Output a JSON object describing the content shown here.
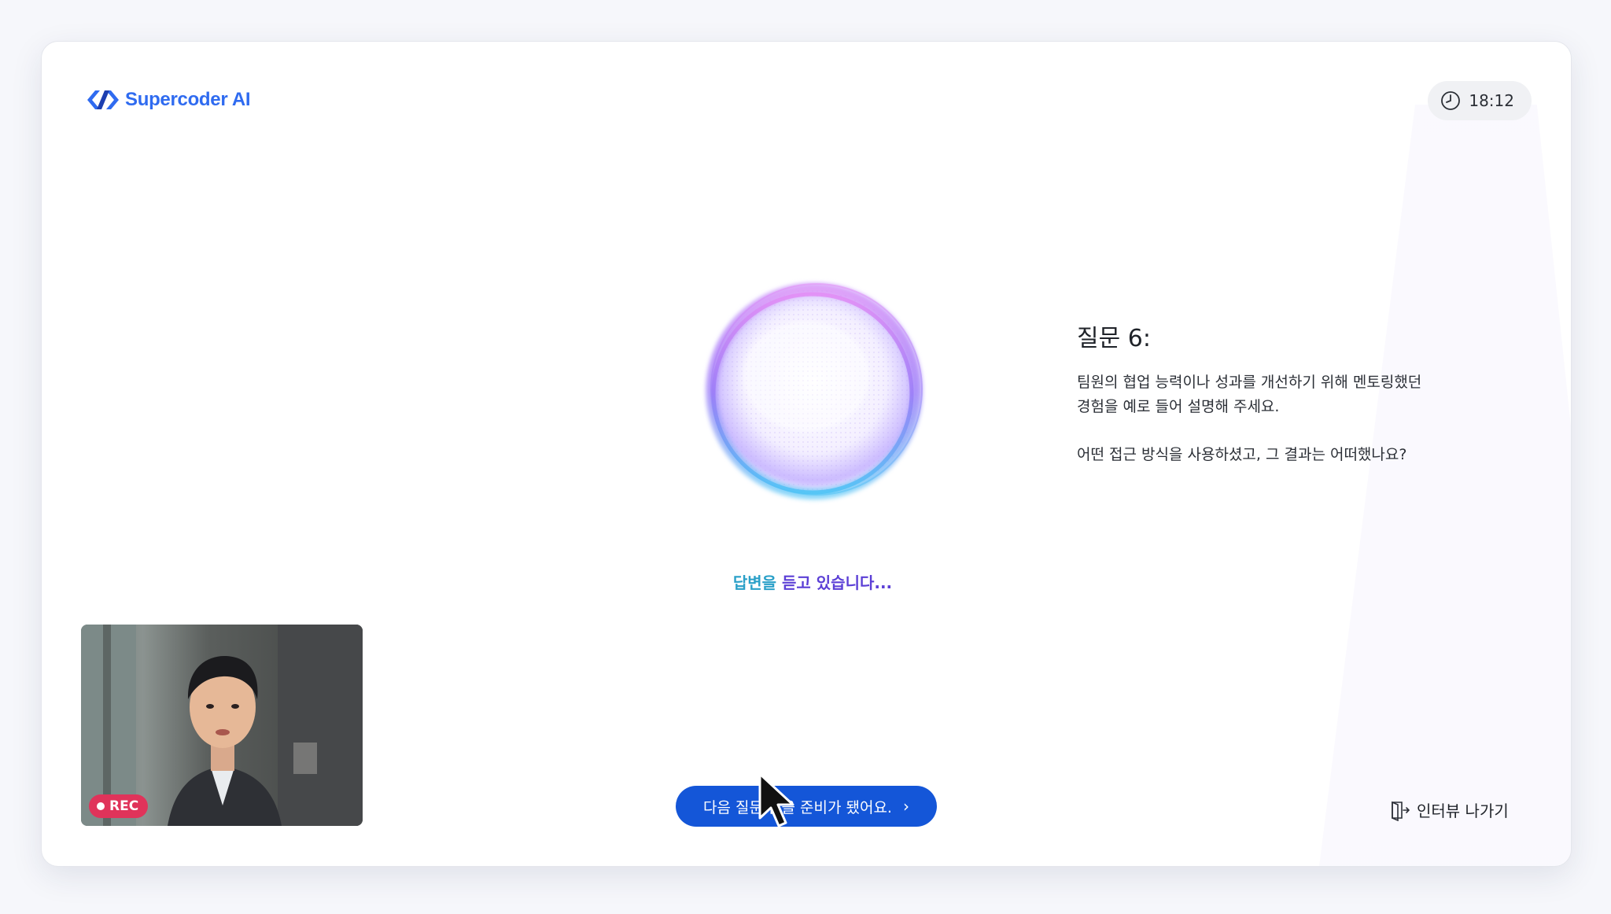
{
  "brand": {
    "name": "Supercoder AI",
    "accent": "#2f6bf0"
  },
  "timer": {
    "icon": "clock-icon",
    "value": "18:12"
  },
  "status": {
    "part1": "답변을 ",
    "part2": "듣고 있습니다...",
    "colors": [
      "#2aa0c8",
      "#5b3fd6"
    ]
  },
  "question": {
    "title": "질문 6:",
    "line1": "팀원의 협업 능력이나 성과를 개선하기 위해 멘토링했던",
    "line2": "경험을 예로 들어 설명해 주세요.",
    "line3": "어떤 접근 방식을 사용하셨고, 그 결과는 어떠했나요?"
  },
  "video": {
    "rec_label": "REC",
    "rec_color": "#e0335a"
  },
  "next_button": {
    "label": "다음 질문 받을 준비가 됐어요.",
    "icon": "chevron-right-icon",
    "color": "#1456d8"
  },
  "exit": {
    "label": "인터뷰 나가기",
    "icon": "exit-door-icon"
  }
}
